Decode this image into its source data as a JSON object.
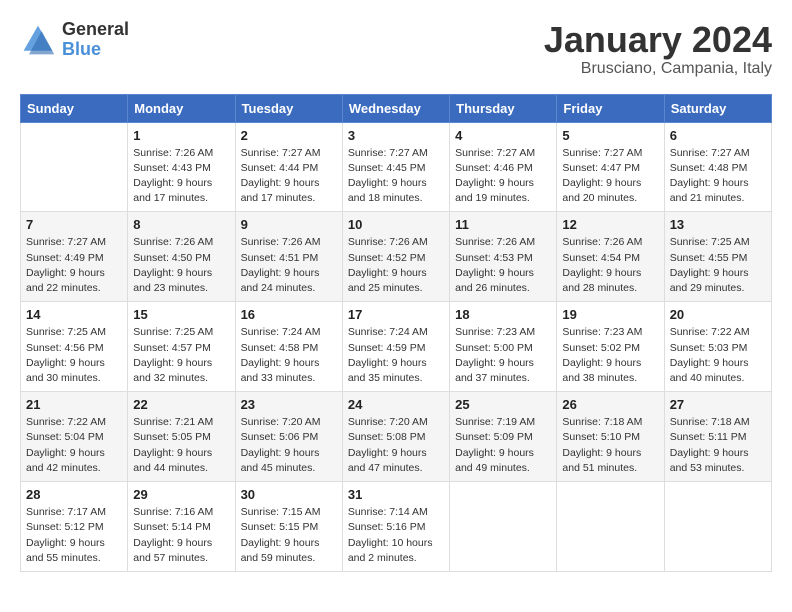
{
  "header": {
    "logo_general": "General",
    "logo_blue": "Blue",
    "month_title": "January 2024",
    "location": "Brusciano, Campania, Italy"
  },
  "days_of_week": [
    "Sunday",
    "Monday",
    "Tuesday",
    "Wednesday",
    "Thursday",
    "Friday",
    "Saturday"
  ],
  "weeks": [
    [
      {
        "day": "",
        "info": ""
      },
      {
        "day": "1",
        "info": "Sunrise: 7:26 AM\nSunset: 4:43 PM\nDaylight: 9 hours\nand 17 minutes."
      },
      {
        "day": "2",
        "info": "Sunrise: 7:27 AM\nSunset: 4:44 PM\nDaylight: 9 hours\nand 17 minutes."
      },
      {
        "day": "3",
        "info": "Sunrise: 7:27 AM\nSunset: 4:45 PM\nDaylight: 9 hours\nand 18 minutes."
      },
      {
        "day": "4",
        "info": "Sunrise: 7:27 AM\nSunset: 4:46 PM\nDaylight: 9 hours\nand 19 minutes."
      },
      {
        "day": "5",
        "info": "Sunrise: 7:27 AM\nSunset: 4:47 PM\nDaylight: 9 hours\nand 20 minutes."
      },
      {
        "day": "6",
        "info": "Sunrise: 7:27 AM\nSunset: 4:48 PM\nDaylight: 9 hours\nand 21 minutes."
      }
    ],
    [
      {
        "day": "7",
        "info": "Sunrise: 7:27 AM\nSunset: 4:49 PM\nDaylight: 9 hours\nand 22 minutes."
      },
      {
        "day": "8",
        "info": "Sunrise: 7:26 AM\nSunset: 4:50 PM\nDaylight: 9 hours\nand 23 minutes."
      },
      {
        "day": "9",
        "info": "Sunrise: 7:26 AM\nSunset: 4:51 PM\nDaylight: 9 hours\nand 24 minutes."
      },
      {
        "day": "10",
        "info": "Sunrise: 7:26 AM\nSunset: 4:52 PM\nDaylight: 9 hours\nand 25 minutes."
      },
      {
        "day": "11",
        "info": "Sunrise: 7:26 AM\nSunset: 4:53 PM\nDaylight: 9 hours\nand 26 minutes."
      },
      {
        "day": "12",
        "info": "Sunrise: 7:26 AM\nSunset: 4:54 PM\nDaylight: 9 hours\nand 28 minutes."
      },
      {
        "day": "13",
        "info": "Sunrise: 7:25 AM\nSunset: 4:55 PM\nDaylight: 9 hours\nand 29 minutes."
      }
    ],
    [
      {
        "day": "14",
        "info": "Sunrise: 7:25 AM\nSunset: 4:56 PM\nDaylight: 9 hours\nand 30 minutes."
      },
      {
        "day": "15",
        "info": "Sunrise: 7:25 AM\nSunset: 4:57 PM\nDaylight: 9 hours\nand 32 minutes."
      },
      {
        "day": "16",
        "info": "Sunrise: 7:24 AM\nSunset: 4:58 PM\nDaylight: 9 hours\nand 33 minutes."
      },
      {
        "day": "17",
        "info": "Sunrise: 7:24 AM\nSunset: 4:59 PM\nDaylight: 9 hours\nand 35 minutes."
      },
      {
        "day": "18",
        "info": "Sunrise: 7:23 AM\nSunset: 5:00 PM\nDaylight: 9 hours\nand 37 minutes."
      },
      {
        "day": "19",
        "info": "Sunrise: 7:23 AM\nSunset: 5:02 PM\nDaylight: 9 hours\nand 38 minutes."
      },
      {
        "day": "20",
        "info": "Sunrise: 7:22 AM\nSunset: 5:03 PM\nDaylight: 9 hours\nand 40 minutes."
      }
    ],
    [
      {
        "day": "21",
        "info": "Sunrise: 7:22 AM\nSunset: 5:04 PM\nDaylight: 9 hours\nand 42 minutes."
      },
      {
        "day": "22",
        "info": "Sunrise: 7:21 AM\nSunset: 5:05 PM\nDaylight: 9 hours\nand 44 minutes."
      },
      {
        "day": "23",
        "info": "Sunrise: 7:20 AM\nSunset: 5:06 PM\nDaylight: 9 hours\nand 45 minutes."
      },
      {
        "day": "24",
        "info": "Sunrise: 7:20 AM\nSunset: 5:08 PM\nDaylight: 9 hours\nand 47 minutes."
      },
      {
        "day": "25",
        "info": "Sunrise: 7:19 AM\nSunset: 5:09 PM\nDaylight: 9 hours\nand 49 minutes."
      },
      {
        "day": "26",
        "info": "Sunrise: 7:18 AM\nSunset: 5:10 PM\nDaylight: 9 hours\nand 51 minutes."
      },
      {
        "day": "27",
        "info": "Sunrise: 7:18 AM\nSunset: 5:11 PM\nDaylight: 9 hours\nand 53 minutes."
      }
    ],
    [
      {
        "day": "28",
        "info": "Sunrise: 7:17 AM\nSunset: 5:12 PM\nDaylight: 9 hours\nand 55 minutes."
      },
      {
        "day": "29",
        "info": "Sunrise: 7:16 AM\nSunset: 5:14 PM\nDaylight: 9 hours\nand 57 minutes."
      },
      {
        "day": "30",
        "info": "Sunrise: 7:15 AM\nSunset: 5:15 PM\nDaylight: 9 hours\nand 59 minutes."
      },
      {
        "day": "31",
        "info": "Sunrise: 7:14 AM\nSunset: 5:16 PM\nDaylight: 10 hours\nand 2 minutes."
      },
      {
        "day": "",
        "info": ""
      },
      {
        "day": "",
        "info": ""
      },
      {
        "day": "",
        "info": ""
      }
    ]
  ]
}
